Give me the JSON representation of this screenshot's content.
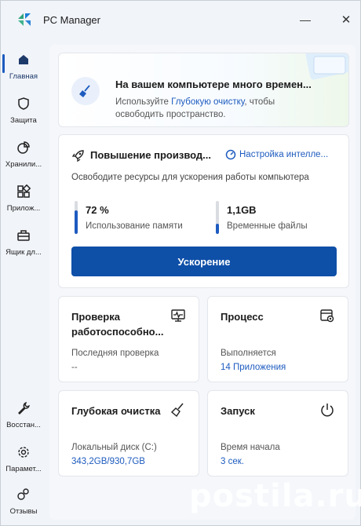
{
  "window": {
    "title": "PC Manager",
    "minimize_symbol": "—",
    "close_symbol": "✕"
  },
  "sidebar": {
    "items": [
      {
        "label": "Главная",
        "icon": "home-icon",
        "active": true
      },
      {
        "label": "Защита",
        "icon": "shield-icon"
      },
      {
        "label": "Хранили...",
        "icon": "storage-pie-icon"
      },
      {
        "label": "Прилож...",
        "icon": "apps-grid-icon"
      },
      {
        "label": "Ящик дл...",
        "icon": "toolbox-icon"
      },
      {
        "label": "Восстан...",
        "icon": "wrench-icon"
      },
      {
        "label": "Парамет...",
        "icon": "gear-icon"
      },
      {
        "label": "Отзывы",
        "icon": "feedback-icon"
      }
    ]
  },
  "banner": {
    "title": "На вашем компьютере много времен...",
    "sub_prefix": "Используйте ",
    "sub_link": "Глубокую очистку",
    "sub_suffix": ", чтобы освободить пространство.",
    "icon": "broom-icon"
  },
  "performance": {
    "title": "Повышение производ...",
    "settings_label": "Настройка интелле...",
    "subtitle": "Освободите ресурсы для ускорения работы компьютера",
    "memory": {
      "value": "72 %",
      "label": "Использование памяти",
      "fill_fraction": 0.72
    },
    "temp": {
      "value": "1,1GB",
      "label": "Временные файлы",
      "fill_fraction": 0.3
    },
    "boost_label": "Ускорение",
    "accent_color": "#0e4fa8"
  },
  "tiles": {
    "health": {
      "title": "Проверка работоспособно...",
      "label": "Последняя проверка",
      "value": "--",
      "icon": "monitor-pulse-icon"
    },
    "process": {
      "title": "Процесс",
      "label": "Выполняется",
      "value": "14 Приложения",
      "icon": "window-gear-icon"
    },
    "deepclean": {
      "title": "Глубокая очистка",
      "label": "Локальный диск (C:)",
      "value": "343,2GB/930,7GB",
      "icon": "broom-icon"
    },
    "startup": {
      "title": "Запуск",
      "label": "Время начала",
      "value": "3 сек.",
      "icon": "power-icon"
    }
  },
  "watermark": "postila.ru"
}
